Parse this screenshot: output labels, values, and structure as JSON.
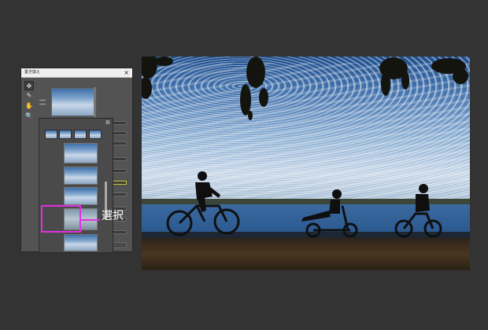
{
  "dialog": {
    "title": "置き換え",
    "close_glyph": "×",
    "tools": [
      {
        "icon": "move-icon",
        "glyph": "✥"
      },
      {
        "icon": "brush-icon",
        "glyph": "✎"
      },
      {
        "icon": "hand-icon",
        "glyph": "✋"
      },
      {
        "icon": "zoom-icon",
        "glyph": "🔍"
      }
    ],
    "gear_glyph": "⚙"
  },
  "annotation": {
    "label": "選択",
    "color": "#e030e0"
  },
  "colors": {
    "background": "#333333",
    "panel": "#535353",
    "highlight": "#e030e0"
  }
}
